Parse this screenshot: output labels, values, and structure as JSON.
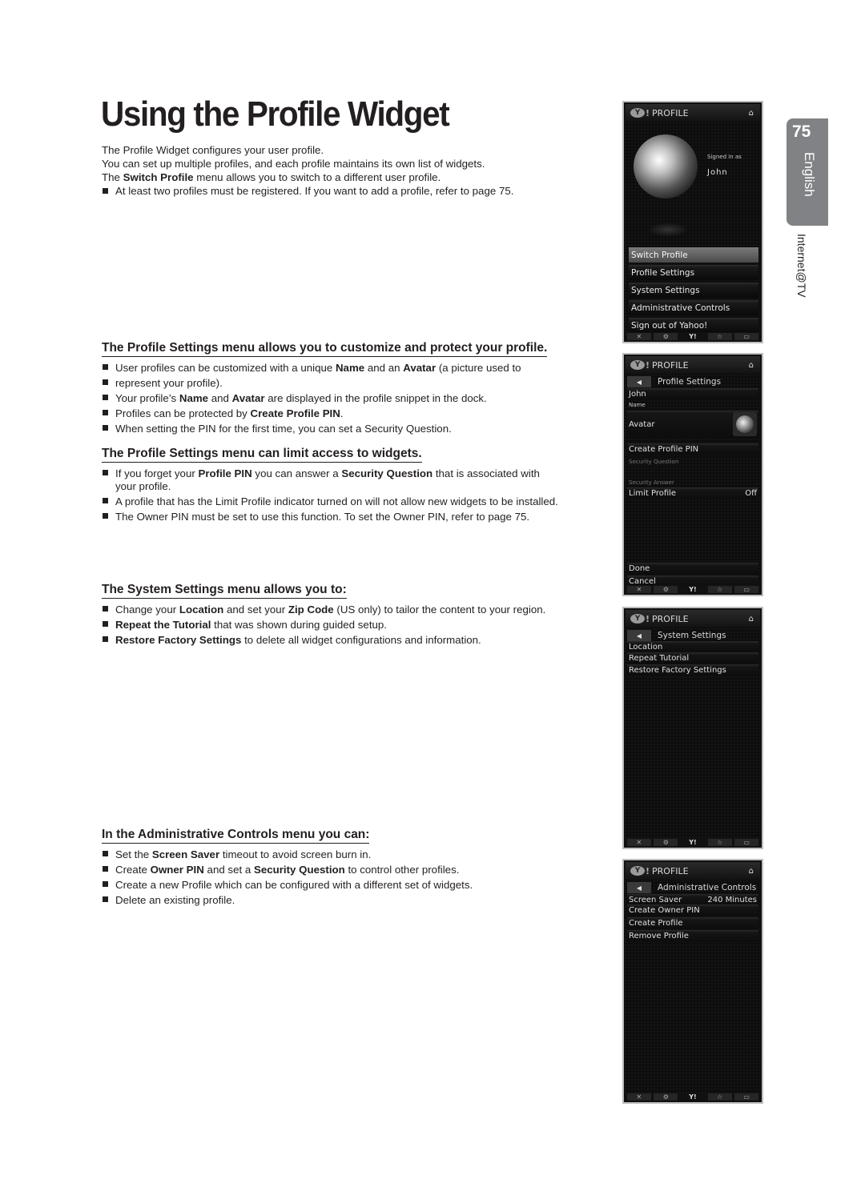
{
  "page": {
    "title": "Using the Profile Widget",
    "intro": [
      "The Profile Widget configures your user profile.",
      "You can set up multiple profiles, and each profile maintains its own list of widgets."
    ],
    "intro_switch": {
      "pre": "The ",
      "bold": "Switch Profile",
      "post": " menu allows you to switch to a different user profile."
    },
    "intro_note": "At least two profiles must be registered. If you want to add a profile, refer to page 75."
  },
  "side_tab": {
    "page_number": "75",
    "language": "English",
    "section": "Internet@TV"
  },
  "sections": {
    "profile_settings": {
      "heading": "The Profile Settings menu allows you to customize and protect your profile.",
      "b1": {
        "t1": "User profiles can be customized with a unique ",
        "b1": "Name",
        "t2": " and an ",
        "b2": "Avatar",
        "t3": " (a picture used to"
      },
      "b1_cont": "represent your profile).",
      "b2": {
        "t1": "Your profile’s ",
        "b1": "Name",
        "t2": " and ",
        "b2": "Avatar",
        "t3": " are displayed in the profile snippet in the dock."
      },
      "b3": {
        "t1": "Profiles can be protected by ",
        "b1": "Create Profile PIN",
        "t2": "."
      },
      "b4": "When setting the PIN for the first time, you can set a Security Question."
    },
    "limit_access": {
      "heading": "The Profile Settings menu can limit access to widgets.",
      "b1": {
        "t1": "If you forget your ",
        "b1": "Profile PIN",
        "t2": " you can answer a ",
        "b2": "Security Question",
        "t3": " that is associated with"
      },
      "b1_cont": "your profile.",
      "b2": "A profile that has the Limit Profile indicator turned on will not allow new widgets to be installed.",
      "b3": "The Owner PIN must be set to use this function. To set the Owner PIN, refer to page 75."
    },
    "system_settings": {
      "heading": "The System Settings menu allows you to:",
      "b1": {
        "t1": "Change your ",
        "b1": "Location",
        "t2": " and set your ",
        "b2": "Zip Code",
        "t3": " (US only) to tailor the content to your region."
      },
      "b2": {
        "b1": "Repeat the Tutorial",
        "t1": " that was shown during guided setup."
      },
      "b3": {
        "b1": "Restore Factory Settings",
        "t1": " to delete all widget configurations and information."
      }
    },
    "admin_controls": {
      "heading": "In the Administrative Controls menu you can:",
      "b1": {
        "t1": "Set the ",
        "b1": "Screen Saver",
        "t2": " timeout to avoid screen burn in."
      },
      "b2": {
        "t1": "Create ",
        "b1": "Owner PIN",
        "t2": " and set a ",
        "b2": "Security Question",
        "t3": " to control other profiles."
      },
      "b3": "Create a new Profile which can be configured with a different set of widgets.",
      "b4": "Delete an existing profile."
    }
  },
  "panels": {
    "header_title": "PROFILE",
    "yahoo_logo": "Y",
    "back_icon": "◀",
    "home_icon": "⌂",
    "dock": [
      "✕",
      "⚙",
      "Y!",
      "☆",
      "▭"
    ],
    "main": {
      "signed_in_label": "Signed in as",
      "user_name": "John",
      "menu": [
        "Switch Profile",
        "Profile Settings",
        "System Settings",
        "Administrative Controls",
        "Sign out of Yahoo!"
      ],
      "selected_index": 0
    },
    "profile_settings": {
      "subtitle": "Profile Settings",
      "name_value": "John",
      "name_label": "Name",
      "avatar_label": "Avatar",
      "create_pin": "Create Profile PIN",
      "security_question": "Security Question",
      "security_answer": "Security Answer",
      "limit_profile": "Limit Profile",
      "limit_profile_value": "Off",
      "done": "Done",
      "cancel": "Cancel"
    },
    "system_settings": {
      "subtitle": "System Settings",
      "items": [
        "Location",
        "Repeat Tutorial",
        "Restore Factory Settings"
      ]
    },
    "admin_controls": {
      "subtitle": "Administrative Controls",
      "screen_saver": "Screen Saver",
      "screen_saver_value": "240 Minutes",
      "items": [
        "Create Owner PIN",
        "Create Profile",
        "Remove Profile"
      ]
    }
  }
}
